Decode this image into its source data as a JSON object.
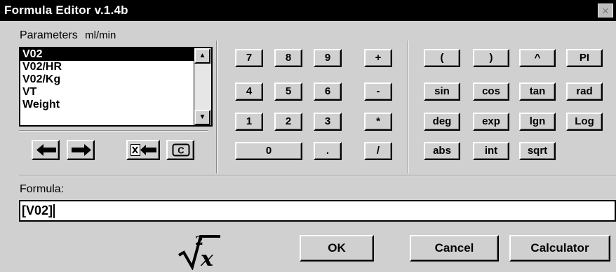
{
  "window": {
    "title": "Formula Editor v.1.4b",
    "close_glyph": "×"
  },
  "parameters": {
    "label": "Parameters",
    "unit": "ml/min",
    "items": [
      "V02",
      "V02/HR",
      "V02/Kg",
      "VT",
      "Weight"
    ],
    "selected": "V02"
  },
  "keypad": {
    "row1": [
      "7",
      "8",
      "9",
      "+"
    ],
    "row2": [
      "4",
      "5",
      "6",
      "-"
    ],
    "row3": [
      "1",
      "2",
      "3",
      "*"
    ],
    "row4": [
      "0",
      ".",
      "/"
    ]
  },
  "functions": {
    "row1": [
      "(",
      ")",
      "^",
      "PI"
    ],
    "row2": [
      "sin",
      "cos",
      "tan",
      "rad"
    ],
    "row3": [
      "deg",
      "exp",
      "lgn",
      "Log"
    ],
    "row4": [
      "abs",
      "int",
      "sqrt"
    ]
  },
  "nav_icons": [
    "arrow-left-icon",
    "arrow-right-icon",
    "delete-left-icon",
    "clear-icon"
  ],
  "nav_clear_glyph": "C",
  "formula": {
    "label": "Formula:",
    "value": "[V02]"
  },
  "buttons": {
    "ok": "OK",
    "cancel": "Cancel",
    "calculator": "Calculator"
  }
}
